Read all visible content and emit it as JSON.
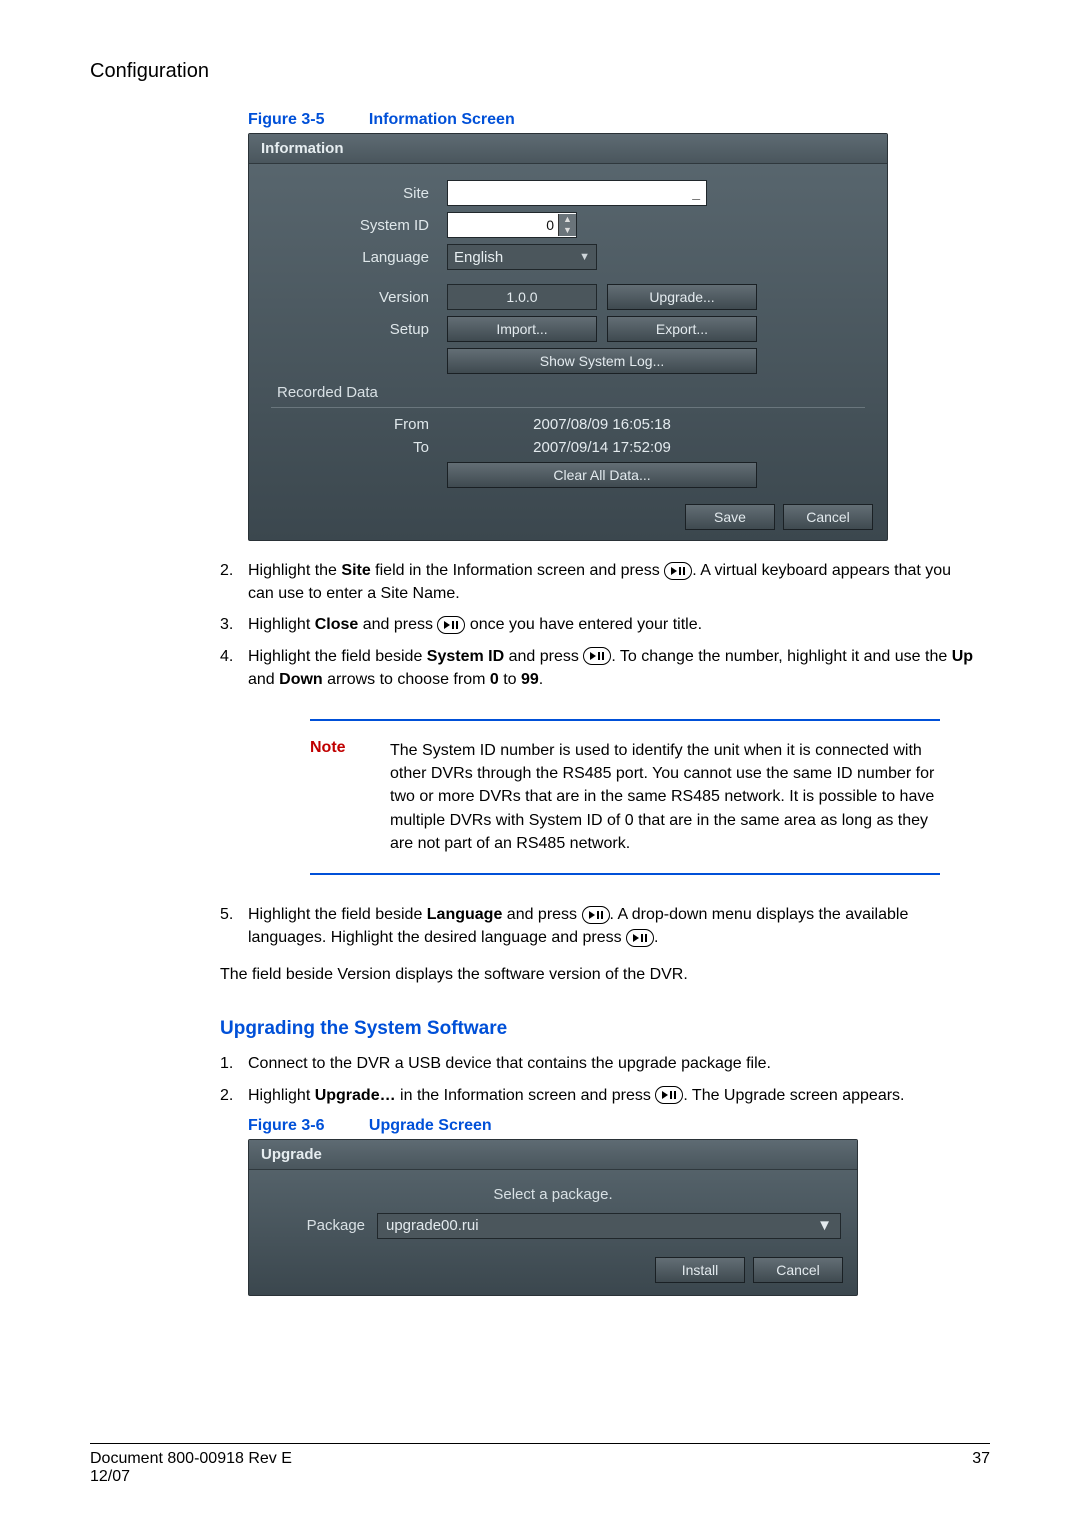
{
  "header": "Configuration",
  "figure1": {
    "num": "Figure 3-5",
    "title": "Information Screen"
  },
  "infoDialog": {
    "title": "Information",
    "labels": {
      "site": "Site",
      "systemId": "System ID",
      "language": "Language",
      "version": "Version",
      "setup": "Setup"
    },
    "values": {
      "systemId": "0",
      "language": "English",
      "version": "1.0.0"
    },
    "buttons": {
      "upgrade": "Upgrade...",
      "import": "Import...",
      "export": "Export...",
      "showLog": "Show System Log...",
      "clearAll": "Clear All Data...",
      "save": "Save",
      "cancel": "Cancel"
    },
    "recorded": {
      "heading": "Recorded Data",
      "fromLabel": "From",
      "toLabel": "To",
      "from": "2007/08/09  16:05:18",
      "to": "2007/09/14  17:52:09"
    }
  },
  "steps1": [
    {
      "n": "2.",
      "pre": "Highlight the ",
      "b1": "Site",
      "mid": " field in the Information screen and press ",
      "after": ". A virtual keyboard appears that you can use to enter a Site Name."
    },
    {
      "n": "3.",
      "pre": "Highlight ",
      "b1": "Close",
      "mid": " and press ",
      "after": " once you have entered your title."
    },
    {
      "n": "4.",
      "pre": "Highlight the field beside ",
      "b1": "System ID",
      "mid": " and press ",
      "after": ". To change the number, highlight it and use the ",
      "b2": "Up",
      "mid2": " and ",
      "b3": "Down",
      "tail": " arrows to choose from ",
      "b4": "0",
      "to": " to ",
      "b5": "99",
      "dot": "."
    }
  ],
  "note": {
    "label": "Note",
    "text": "The System ID number is used to identify the unit when it is connected with other DVRs through the RS485 port. You cannot use the same ID number for two or more DVRs that are in the same RS485 network. It is possible to have multiple DVRs with System ID of 0 that are in the same area as long as they are not part of an RS485 network."
  },
  "step5": {
    "n": "5.",
    "pre": "Highlight the field beside ",
    "b1": "Language",
    "mid": " and press ",
    "after": ". A drop-down menu displays the available languages. Highlight the desired language and press ",
    "dot": "."
  },
  "versionNote": "The field beside Version displays the software version of the DVR.",
  "upgradeHead": "Upgrading the System Software",
  "upgradeSteps": [
    {
      "n": "1.",
      "text": "Connect to the DVR a USB device that contains the upgrade package file."
    },
    {
      "n": "2.",
      "pre": "Highlight ",
      "b1": "Upgrade…",
      "mid": " in the Information screen and press ",
      "after": ". The Upgrade screen appears."
    }
  ],
  "figure2": {
    "num": "Figure 3-6",
    "title": "Upgrade Screen"
  },
  "upgradeDialog": {
    "title": "Upgrade",
    "prompt": "Select a package.",
    "pkgLabel": "Package",
    "pkgValue": "upgrade00.rui",
    "install": "Install",
    "cancel": "Cancel"
  },
  "footer": {
    "left1": "Document 800-00918 Rev E",
    "left2": "12/07",
    "right": "37"
  }
}
